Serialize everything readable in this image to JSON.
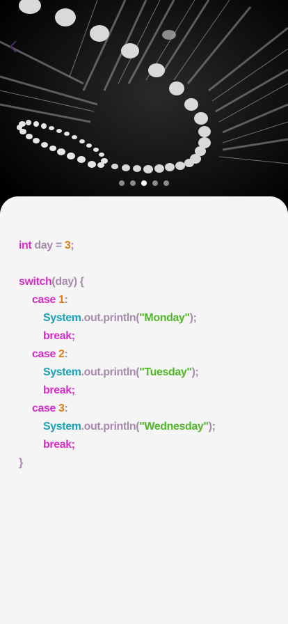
{
  "hero": {
    "image": "abstract-dark-architecture-photo",
    "pager": {
      "count": 5,
      "active_index": 2
    }
  },
  "code": {
    "l1": {
      "kw": "int",
      "var": "day",
      "eq": " = ",
      "num": "3",
      "semi": ";"
    },
    "l3": {
      "kw": "switch",
      "rest": "(day) {"
    },
    "l4": {
      "kw": "case",
      "num": "1",
      "colon": ":"
    },
    "l5": {
      "cls": "System",
      "mid": ".out.println(",
      "str": "\"Monday\"",
      "end": ");"
    },
    "l6": {
      "kw": "break;"
    },
    "l7": {
      "kw": "case",
      "num": "2",
      "colon": ":"
    },
    "l8": {
      "cls": "System",
      "mid": ".out.println(",
      "str": "\"Tuesday\"",
      "end": ");"
    },
    "l9": {
      "kw": "break;"
    },
    "l10": {
      "kw": "case",
      "num": "3",
      "colon": ":"
    },
    "l11": {
      "cls": "System",
      "mid": ".out.println(",
      "str": "\"Wednesday\"",
      "end": ");"
    },
    "l12": {
      "kw": "break;"
    },
    "l13": {
      "close": "}"
    }
  }
}
